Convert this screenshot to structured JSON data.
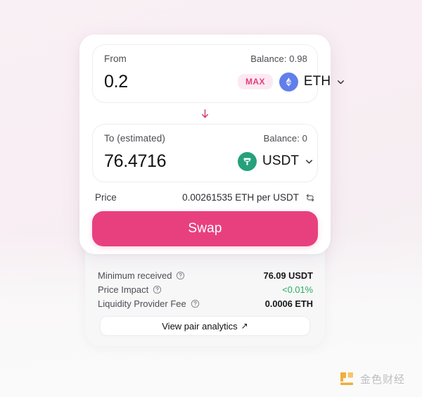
{
  "theme": {
    "background": "#f8eff4",
    "card_background": "#ffffff",
    "detail_card_background": "#f7f7f8",
    "accent": "#e8407f",
    "accent_soft_bg": "#fde9f1",
    "accent_text": "#e2407a",
    "arrow_color": "#d4306f",
    "eth_color": "#627eea",
    "usdt_color": "#26a17b",
    "positive_color": "#27ae60",
    "watermark_color": "#b9b9bd",
    "watermark_mark_color": "#f0a82a"
  },
  "swap": {
    "from": {
      "label": "From",
      "balance": "Balance: 0.98",
      "amount": "0.2",
      "amount_placeholder": "0.0",
      "max_label": "MAX",
      "token": {
        "symbol": "ETH",
        "icon": "ethereum-icon"
      }
    },
    "to": {
      "label": "To (estimated)",
      "balance": "Balance: 0",
      "amount": "76.4716",
      "amount_placeholder": "0.0",
      "token": {
        "symbol": "USDT",
        "icon": "tether-icon"
      }
    },
    "divider_icon": "arrow-down-icon",
    "price": {
      "label": "Price",
      "value": "0.00261535 ETH per USDT",
      "refresh_icon": "swap-direction-icon"
    },
    "action_button": {
      "label": "Swap"
    }
  },
  "details": {
    "rows": [
      {
        "label": "Minimum received",
        "help_icon": "help-circle-icon",
        "value": "76.09 USDT",
        "style": "normal"
      },
      {
        "label": "Price Impact",
        "help_icon": "help-circle-icon",
        "value": "<0.01%",
        "style": "positive"
      },
      {
        "label": "Liquidity Provider Fee",
        "help_icon": "help-circle-icon",
        "value": "0.0006 ETH",
        "style": "normal"
      }
    ],
    "analytics_button": {
      "label": "View pair analytics",
      "arrow": "↗"
    }
  },
  "watermark": {
    "text": "金色财经",
    "mark_icon": "jinse-logo-icon"
  }
}
